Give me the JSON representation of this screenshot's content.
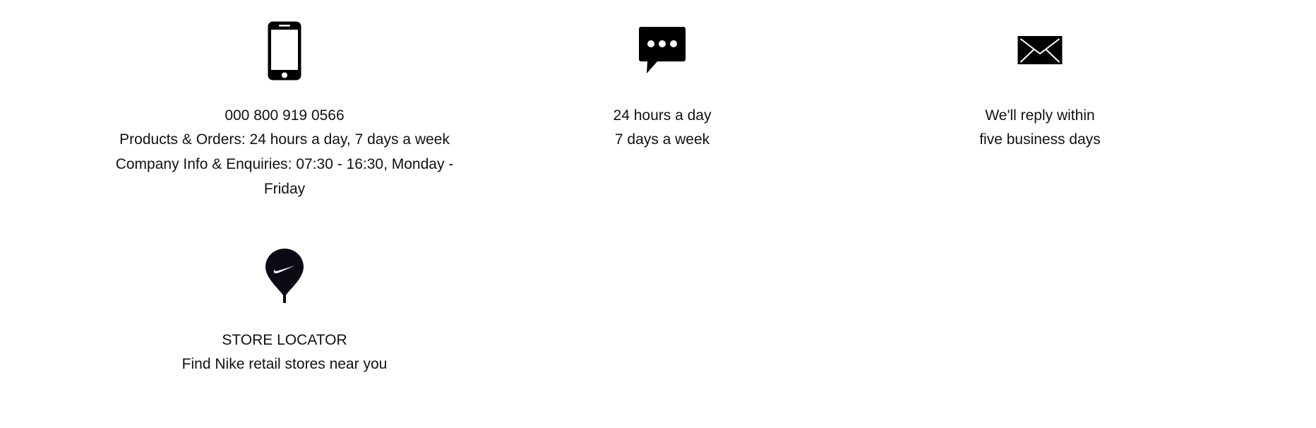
{
  "phone": {
    "icon": "phone-icon",
    "number": "000 800 919 0566",
    "line1": "Products & Orders: 24 hours a day, 7 days a week",
    "line2": "Company Info & Enquiries: 07:30 - 16:30, Monday -",
    "line3": "Friday"
  },
  "chat": {
    "icon": "chat-icon",
    "title": "24 hours a day",
    "line1": "7 days a week"
  },
  "email": {
    "icon": "mail-icon",
    "title": "We'll reply within",
    "line1": "five business days"
  },
  "store": {
    "icon": "store-locator-pin-icon",
    "title": "STORE LOCATOR",
    "line1": "Find Nike retail stores near you"
  },
  "colors": {
    "icon": "#000000",
    "text": "#111111",
    "background": "#ffffff"
  }
}
